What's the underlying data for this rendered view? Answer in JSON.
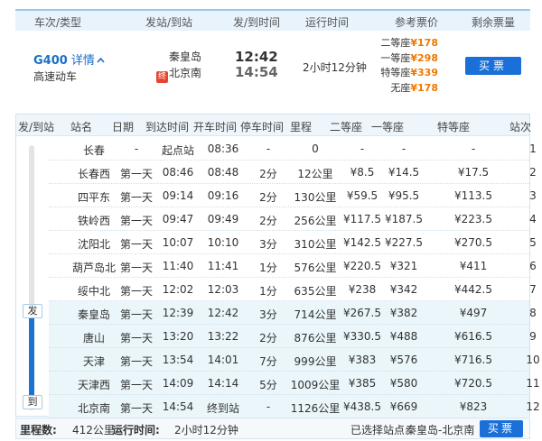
{
  "header": {
    "col_train": "车次/类型",
    "col_stations": "发站/到站",
    "col_times": "发/到时间",
    "col_duration": "运行时间",
    "col_prices": "参考票价",
    "col_remaining": "剩余票量"
  },
  "train": {
    "number": "G400",
    "detail_label": "详情",
    "detail_icon": "chevron-up-icon",
    "type": "高速动车",
    "from_station": "秦皇岛",
    "to_station": "北京南",
    "terminal_badge": "终",
    "depart_time": "12:42",
    "arrive_time": "14:54",
    "duration": "2小时12分钟",
    "prices": [
      {
        "label": "二等座",
        "price": "¥178"
      },
      {
        "label": "一等座",
        "price": "¥298"
      },
      {
        "label": "特等座",
        "price": "¥339"
      },
      {
        "label": "无座",
        "price": "¥178"
      }
    ],
    "buy_label": "买票"
  },
  "stops_header": {
    "from_to": "发/到站",
    "station": "站名",
    "date": "日期",
    "arrive": "到达时间",
    "depart": "开车时间",
    "stop": "停车时间",
    "distance": "里程",
    "second": "二等座",
    "first": "一等座",
    "special": "特等座",
    "index": "站次"
  },
  "stops": [
    {
      "station": "长春",
      "date": "-",
      "arrive": "起点站",
      "depart": "08:36",
      "stop": "-",
      "distance": "0",
      "second": "-",
      "first": "-",
      "special": "-",
      "index": "1"
    },
    {
      "station": "长春西",
      "date": "第一天",
      "arrive": "08:46",
      "depart": "08:48",
      "stop": "2分",
      "distance": "12公里",
      "second": "¥8.5",
      "first": "¥14.5",
      "special": "¥17.5",
      "index": "2"
    },
    {
      "station": "四平东",
      "date": "第一天",
      "arrive": "09:14",
      "depart": "09:16",
      "stop": "2分",
      "distance": "130公里",
      "second": "¥59.5",
      "first": "¥95.5",
      "special": "¥113.5",
      "index": "3"
    },
    {
      "station": "铁岭西",
      "date": "第一天",
      "arrive": "09:47",
      "depart": "09:49",
      "stop": "2分",
      "distance": "256公里",
      "second": "¥117.5",
      "first": "¥187.5",
      "special": "¥223.5",
      "index": "4"
    },
    {
      "station": "沈阳北",
      "date": "第一天",
      "arrive": "10:07",
      "depart": "10:10",
      "stop": "3分",
      "distance": "310公里",
      "second": "¥142.5",
      "first": "¥227.5",
      "special": "¥270.5",
      "index": "5"
    },
    {
      "station": "葫芦岛北",
      "date": "第一天",
      "arrive": "11:40",
      "depart": "11:41",
      "stop": "1分",
      "distance": "576公里",
      "second": "¥220.5",
      "first": "¥321",
      "special": "¥411",
      "index": "6"
    },
    {
      "station": "绥中北",
      "date": "第一天",
      "arrive": "12:02",
      "depart": "12:03",
      "stop": "1分",
      "distance": "635公里",
      "second": "¥238",
      "first": "¥342",
      "special": "¥442.5",
      "index": "7"
    },
    {
      "station": "秦皇岛",
      "date": "第一天",
      "arrive": "12:39",
      "depart": "12:42",
      "stop": "3分",
      "distance": "714公里",
      "second": "¥267.5",
      "first": "¥382",
      "special": "¥497",
      "index": "8"
    },
    {
      "station": "唐山",
      "date": "第一天",
      "arrive": "13:20",
      "depart": "13:22",
      "stop": "2分",
      "distance": "876公里",
      "second": "¥330.5",
      "first": "¥488",
      "special": "¥616.5",
      "index": "9"
    },
    {
      "station": "天津",
      "date": "第一天",
      "arrive": "13:54",
      "depart": "14:01",
      "stop": "7分",
      "distance": "999公里",
      "second": "¥383",
      "first": "¥576",
      "special": "¥716.5",
      "index": "10"
    },
    {
      "station": "天津西",
      "date": "第一天",
      "arrive": "14:09",
      "depart": "14:14",
      "stop": "5分",
      "distance": "1009公里",
      "second": "¥385",
      "first": "¥580",
      "special": "¥720.5",
      "index": "11"
    },
    {
      "station": "北京南",
      "date": "第一天",
      "arrive": "14:54",
      "depart": "终到站",
      "stop": "-",
      "distance": "1126公里",
      "second": "¥438.5",
      "first": "¥669",
      "special": "¥823",
      "index": "12"
    }
  ],
  "rail": {
    "depart_label": "发",
    "arrive_label": "到"
  },
  "footer": {
    "distance_label": "里程数:",
    "distance_value": "412公里",
    "duration_label": "运行时间:",
    "duration_value": "2小时12分钟",
    "selected_label": "已选择站点:",
    "selected_value": "秦皇岛-北京南",
    "buy_label": "买票"
  },
  "colors": {
    "accent": "#1a6fd8",
    "price": "#f07800",
    "header_bg": "#e8f3fb",
    "highlight_bg": "#eaf6fa"
  }
}
